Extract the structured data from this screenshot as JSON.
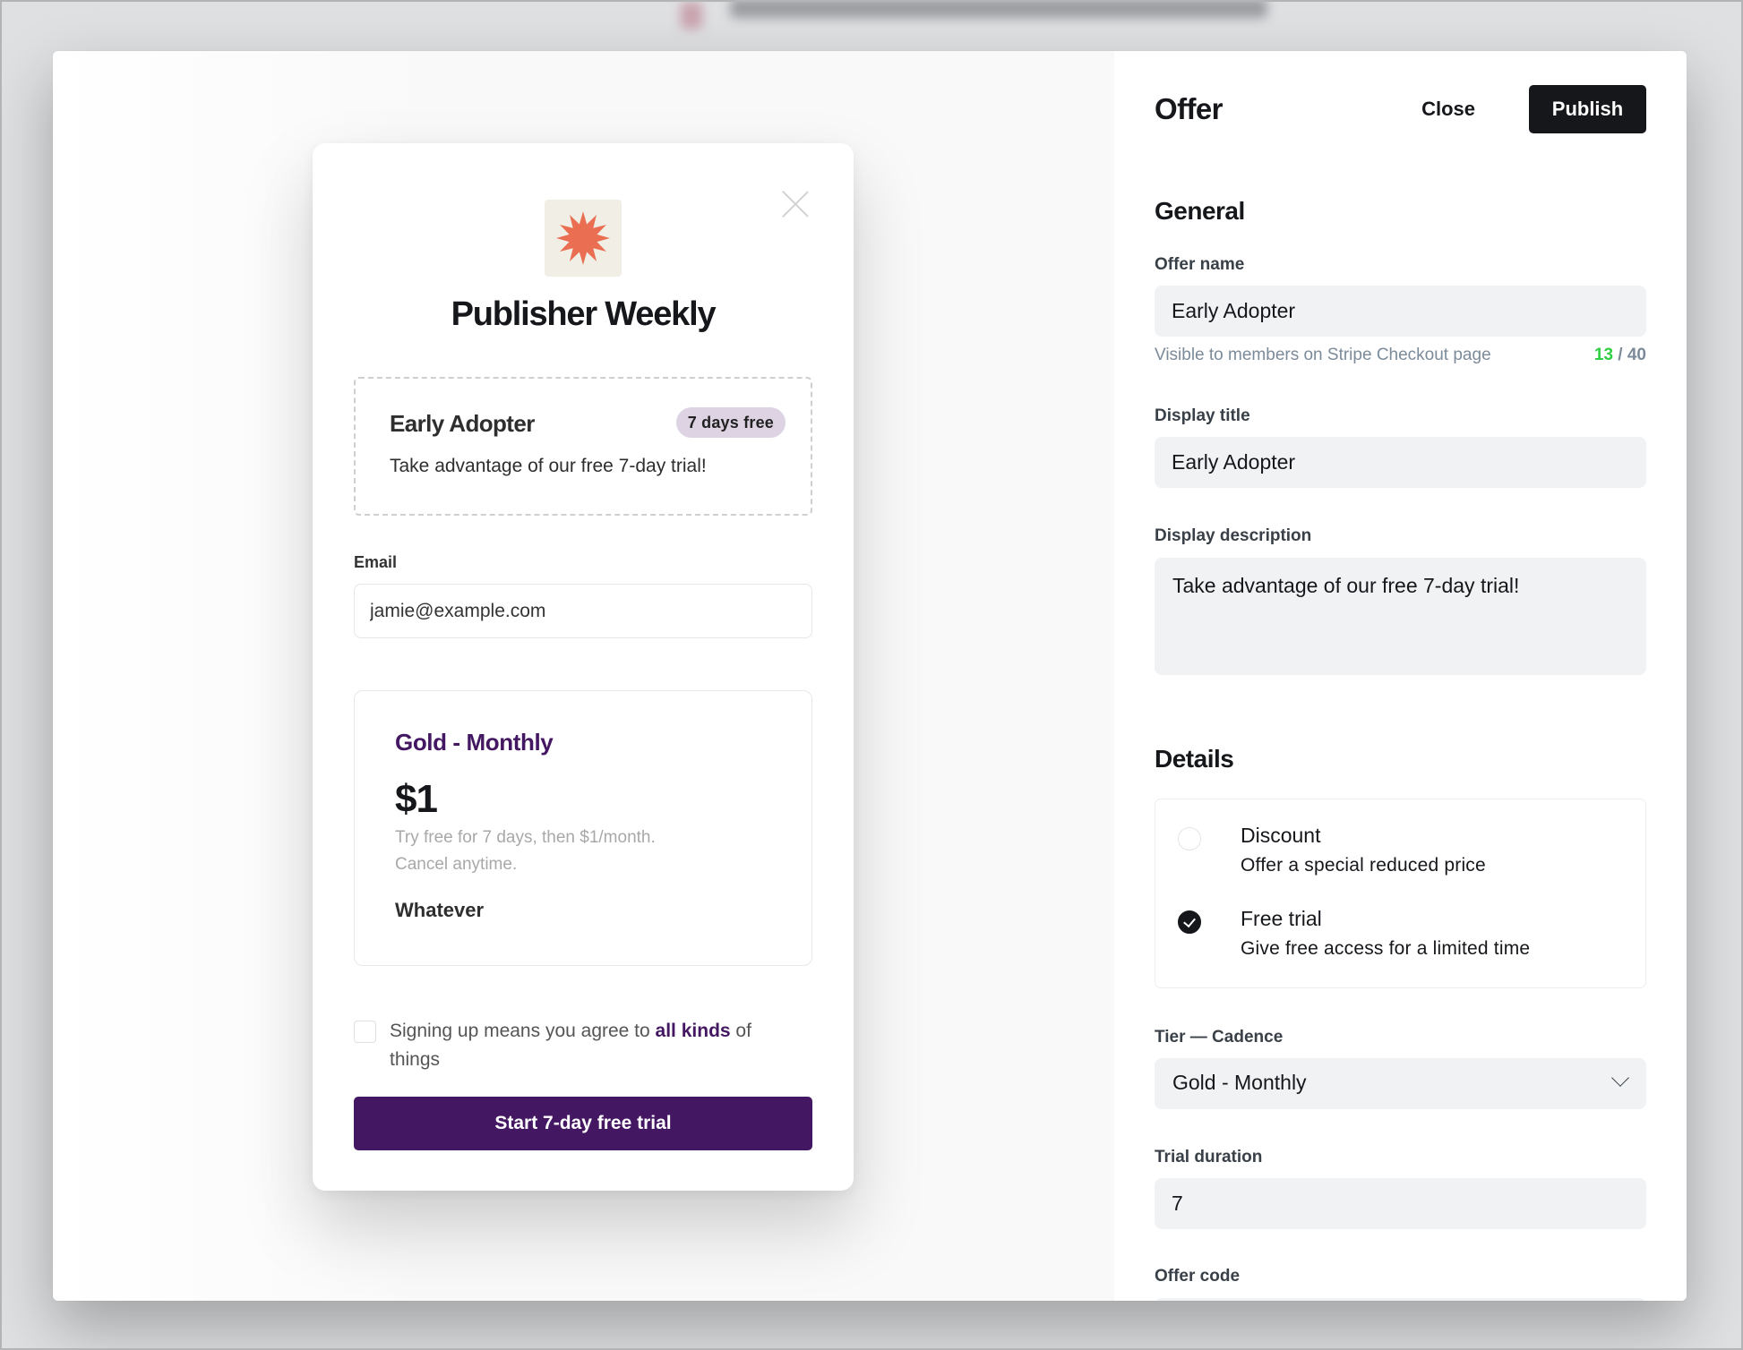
{
  "preview": {
    "publication_name": "Publisher Weekly",
    "logo": {
      "icon": "starburst-icon",
      "color": "#e96e52",
      "background": "#f1efe5"
    },
    "close_icon": "close-icon",
    "offer": {
      "title": "Early Adopter",
      "badge": "7 days free",
      "description": "Take advantage of our free 7-day trial!"
    },
    "email": {
      "label": "Email",
      "value": "jamie@example.com"
    },
    "tier": {
      "name": "Gold - Monthly",
      "price": "$1",
      "note_line1": "Try free for 7 days, then $1/month.",
      "note_line2": "Cancel anytime.",
      "benefit": "Whatever"
    },
    "terms": {
      "checked": false,
      "text_before": "Signing up means you agree to ",
      "link": "all kinds",
      "text_after": " of things"
    },
    "cta_label": "Start 7-day free trial",
    "accent_color": "#441762"
  },
  "panel": {
    "title": "Offer",
    "close_label": "Close",
    "publish_label": "Publish",
    "general": {
      "heading": "General",
      "offer_name": {
        "label": "Offer name",
        "value": "Early Adopter",
        "helper": "Visible to members on Stripe Checkout page",
        "count_current": "13",
        "count_separator": " / ",
        "count_max": "40"
      },
      "display_title": {
        "label": "Display title",
        "value": "Early Adopter"
      },
      "display_description": {
        "label": "Display description",
        "value": "Take advantage of our free 7-day trial!"
      }
    },
    "details": {
      "heading": "Details",
      "options": [
        {
          "title": "Discount",
          "description": "Offer a special reduced price",
          "selected": false
        },
        {
          "title": "Free trial",
          "description": "Give free access for a limited time",
          "selected": true
        }
      ],
      "tier_cadence": {
        "label": "Tier — Cadence",
        "value": "Gold - Monthly"
      },
      "trial_duration": {
        "label": "Trial duration",
        "value": "7"
      },
      "offer_code": {
        "label": "Offer code",
        "value": ""
      }
    }
  }
}
